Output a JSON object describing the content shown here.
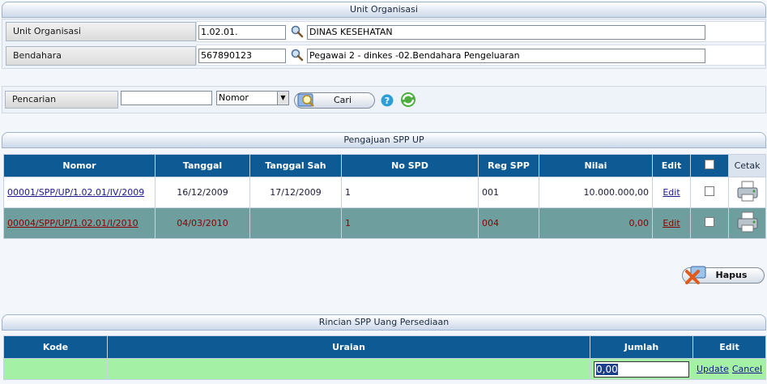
{
  "unit_panel": {
    "title": "Unit Organisasi",
    "unit_label": "Unit Organisasi",
    "unit_code": "1.02.01.",
    "unit_name": "DINAS KESEHATAN",
    "bendahara_label": "Bendahara",
    "bendahara_code": "567890123",
    "bendahara_name": "Pegawai 2 - dinkes -02.Bendahara Pengeluaran"
  },
  "search": {
    "label": "Pencarian",
    "query": "",
    "field_selected": "Nomor",
    "button_label": "Cari"
  },
  "spp_panel": {
    "title": "Pengajuan SPP UP",
    "columns": [
      "Nomor",
      "Tanggal",
      "Tanggal Sah",
      "No SPD",
      "Reg SPP",
      "Nilai",
      "Edit",
      "",
      "Cetak"
    ],
    "rows": [
      {
        "nomor": "00001/SPP/UP/1.02.01/IV/2009",
        "tanggal": "16/12/2009",
        "tanggal_sah": "17/12/2009",
        "no_spd": "1",
        "reg_spp": "001",
        "nilai": "10.000.000,00",
        "edit": "Edit"
      },
      {
        "nomor": "00004/SPP/UP/1.02.01/I/2010",
        "tanggal": "04/03/2010",
        "tanggal_sah": "",
        "no_spd": "1",
        "reg_spp": "004",
        "nilai": "0,00",
        "edit": "Edit"
      }
    ],
    "delete_label": "Hapus"
  },
  "rincian_panel": {
    "title": "Rincian SPP Uang Persediaan",
    "columns": [
      "Kode",
      "Uraian",
      "Jumlah",
      "Edit"
    ],
    "jumlah_value": "0,00",
    "update_label": "Update",
    "cancel_label": "Cancel"
  },
  "colors": {
    "header_blue": "#0e5a94",
    "row_teal": "#6e9e9e",
    "row_text_red": "#8b0000",
    "edit_green": "#a4f0a4"
  }
}
